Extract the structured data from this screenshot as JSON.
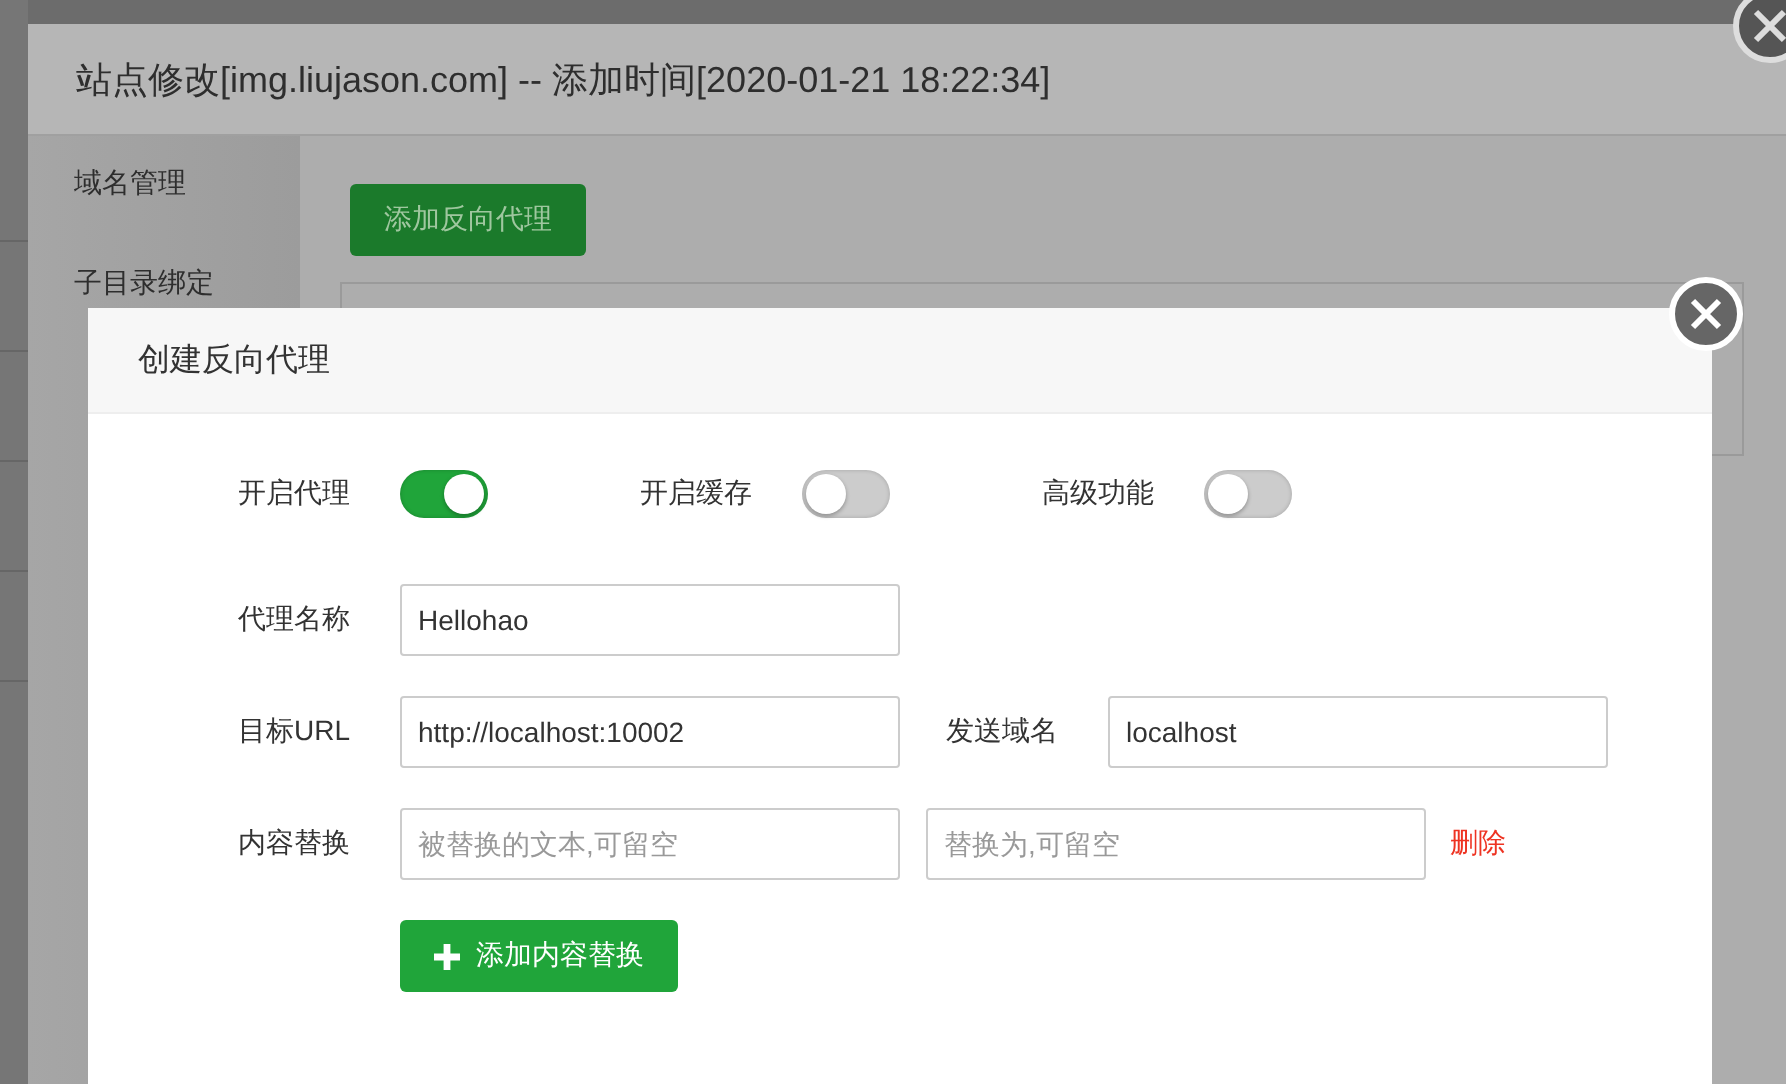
{
  "site_dialog": {
    "title": "站点修改[img.liujason.com] -- 添加时间[2020-01-21 18:22:34]",
    "sidebar": [
      {
        "label": "域名管理"
      },
      {
        "label": "子目录绑定"
      }
    ],
    "add_button": "添加反向代理"
  },
  "proxy_dialog": {
    "title": "创建反向代理",
    "toggles": [
      {
        "label": "开启代理",
        "on": true
      },
      {
        "label": "开启缓存",
        "on": false
      },
      {
        "label": "高级功能",
        "on": false
      }
    ],
    "name": {
      "label": "代理名称",
      "value": "Hellohao"
    },
    "target": {
      "label": "目标URL",
      "value": "http://localhost:10002",
      "host_label": "发送域名",
      "host_value": "localhost"
    },
    "replace": {
      "label": "内容替换",
      "from_placeholder": "被替换的文本,可留空",
      "to_placeholder": "替换为,可留空",
      "delete": "删除"
    },
    "add_replace_button": "添加内容替换"
  }
}
